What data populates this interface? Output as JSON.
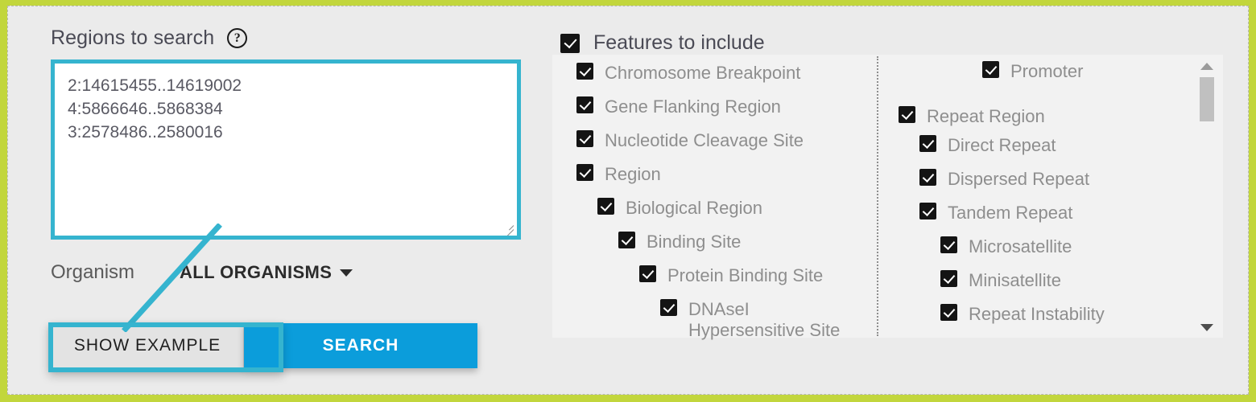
{
  "theme": {
    "outer_border": "#c2d63c",
    "page_bg": "#ebebeb",
    "panel_bg": "#f2f2f2",
    "accent_teal": "#35b4cf",
    "accent_blue": "#0b9ddb",
    "checkbox": "#141414",
    "label_gray": "#8e8e8e",
    "heading_gray": "#4a4a55"
  },
  "left": {
    "regions_label": "Regions to search",
    "help_icon": "help-circle-icon",
    "regions_value": "2:14615455..14619002\n4:5866646..5868384\n3:2578486..2580016",
    "regions_placeholder": "",
    "organism_label": "Organism",
    "organism_selected": "ALL ORGANISMS",
    "organism_caret": "chevron-down-icon",
    "show_example_label": "SHOW EXAMPLE",
    "search_label": "SEARCH"
  },
  "features": {
    "header_label": "Features to include",
    "header_checked": true,
    "column_left": [
      {
        "label": "Chromosome Breakpoint",
        "checked": true,
        "indent": 0
      },
      {
        "label": "Gene Flanking Region",
        "checked": true,
        "indent": 0
      },
      {
        "label": "Nucleotide Cleavage Site",
        "checked": true,
        "indent": 0
      },
      {
        "label": "Region",
        "checked": true,
        "indent": 0
      },
      {
        "label": "Biological Region",
        "checked": true,
        "indent": 1
      },
      {
        "label": "Binding Site",
        "checked": true,
        "indent": 2
      },
      {
        "label": "Protein Binding Site",
        "checked": true,
        "indent": 3
      },
      {
        "label": "DNAseI\nHypersensitive Site",
        "checked": true,
        "indent": 4
      }
    ],
    "column_right": [
      {
        "label": "Promoter",
        "checked": true,
        "indent": 4
      },
      {
        "label": "Repeat Region",
        "checked": true,
        "indent": 0
      },
      {
        "label": "Direct Repeat",
        "checked": true,
        "indent": 1
      },
      {
        "label": "Dispersed Repeat",
        "checked": true,
        "indent": 1
      },
      {
        "label": "Tandem Repeat",
        "checked": true,
        "indent": 1
      },
      {
        "label": "Microsatellite",
        "checked": true,
        "indent": 2
      },
      {
        "label": "Minisatellite",
        "checked": true,
        "indent": 2
      },
      {
        "label": "Repeat Instability",
        "checked": true,
        "indent": 2
      }
    ],
    "scrollbar": {
      "up_arrow": "scroll-up-arrow-icon",
      "down_arrow": "scroll-down-arrow-icon"
    }
  }
}
